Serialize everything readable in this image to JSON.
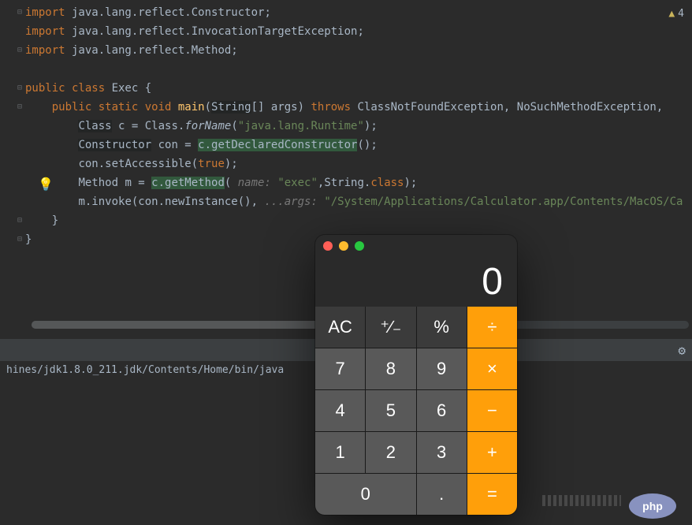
{
  "warn": {
    "count": "4"
  },
  "code": {
    "l1": {
      "kw": "import",
      "pkg": " java.lang.reflect.Constructor;"
    },
    "l2": {
      "kw": "import",
      "pkg": " java.lang.reflect.InvocationTargetException;"
    },
    "l3": {
      "kw": "import",
      "pkg": " java.lang.reflect.Method;"
    },
    "l5": {
      "kw1": "public class ",
      "name": "Exec",
      "rest": " {"
    },
    "l6": {
      "kw1": "public static void ",
      "mth": "main",
      "p1": "(",
      "hl": "String",
      "p2": "[] args) ",
      "kw2": "throws ",
      "rest": "ClassNotFoundException, NoSuchMethodException,"
    },
    "l7": {
      "cls": "Class",
      "mid": " c = Class.",
      "fn": "forName",
      "p1": "(",
      "str": "\"java.lang.Runtime\"",
      "p2": ");"
    },
    "l8": {
      "cls": "Constructor",
      "mid": " con = ",
      "hl": "c.getDeclaredConstructor",
      "p2": "();"
    },
    "l9": {
      "mid": "con.setAccessible(",
      "kw": "true",
      "p2": ");"
    },
    "l10": {
      "pre": "Method m = ",
      "hl": "c.getMethod",
      "p1": "( ",
      "hint": "name: ",
      "str": "\"exec\"",
      "mid": ",",
      "cls": "String",
      "p2": ".",
      "kw": "class",
      "p3": ");"
    },
    "l11": {
      "pre": "m.invoke(con.newInstance(), ",
      "hint": "...args: ",
      "str": "\"/System/Applications/Calculator.app/Contents/MacOS/Ca",
      "end": ""
    },
    "l12": {
      "t": "}"
    },
    "l13": {
      "t": "}"
    }
  },
  "console": {
    "line": "hines/jdk1.8.0_211.jdk/Contents/Home/bin/java"
  },
  "calc": {
    "colors": {
      "close": "#ff5f57",
      "min": "#febc2e",
      "max": "#28c840"
    },
    "display": "0",
    "keys": {
      "ac": "AC",
      "sign": "⁺∕₋",
      "pct": "%",
      "div": "÷",
      "k7": "7",
      "k8": "8",
      "k9": "9",
      "mul": "×",
      "k4": "4",
      "k5": "5",
      "k6": "6",
      "sub": "−",
      "k1": "1",
      "k2": "2",
      "k3": "3",
      "add": "+",
      "k0": "0",
      "dot": ".",
      "eq": "="
    }
  },
  "logo": {
    "text": "php"
  }
}
